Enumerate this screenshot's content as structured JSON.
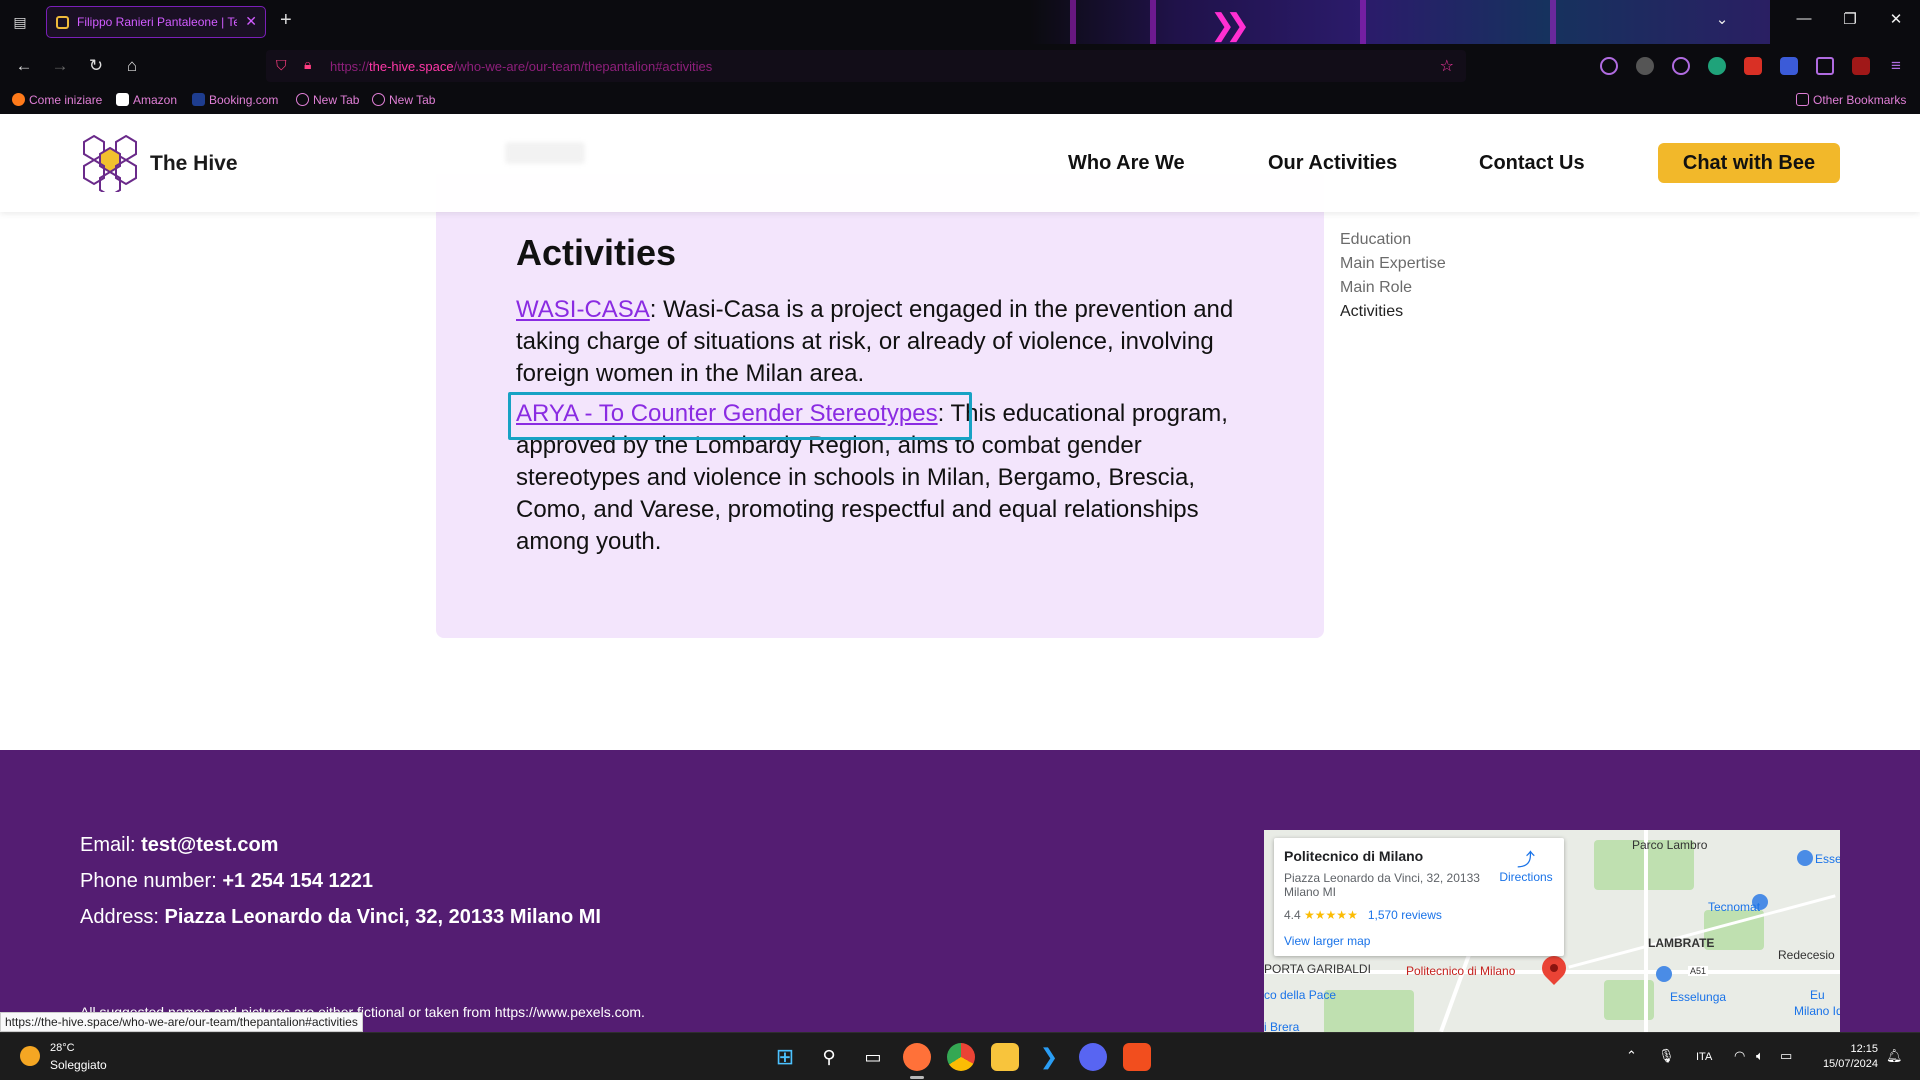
{
  "browser": {
    "tab_title": "Filippo Ranieri Pantaleone | Tea",
    "url_prefix": "https://",
    "url_domain": "the-hive.space",
    "url_path": "/who-we-are/our-team/thepantalion#activities",
    "bookmarks": [
      "Come iniziare",
      "Amazon",
      "Booking.com",
      "New Tab",
      "New Tab"
    ],
    "other_bookmarks": "Other Bookmarks"
  },
  "site": {
    "name": "The Hive",
    "nav": [
      "Who Are We",
      "Our Activities",
      "Contact Us"
    ],
    "cta": "Chat with Bee"
  },
  "activities": {
    "heading": "Activities",
    "items": [
      {
        "link": "WASI-CASA",
        "text": ": Wasi-Casa is a project engaged in the prevention and taking charge of situations at risk, or already of violence, involving foreign women in the Milan area."
      },
      {
        "link": "ARYA - To Counter Gender Stereotypes",
        "text": ": This educational program, approved by the Lombardy Region, aims to combat gender stereotypes and violence in schools in Milan, Bergamo, Brescia, Como, and Varese, promoting respectful and equal relationships among youth."
      }
    ]
  },
  "toc": [
    "Education",
    "Main Expertise",
    "Main Role",
    "Activities"
  ],
  "footer": {
    "email_label": "Email: ",
    "email": "test@test.com",
    "phone_label": "Phone number: ",
    "phone": "+1 254 154 1221",
    "address_label": "Address: ",
    "address": "Piazza Leonardo da Vinci, 32, 20133 Milano MI",
    "disclaimer": "All suggested names and pictures are either fictional or taken from https://www.pexels.com."
  },
  "map": {
    "place": "Politecnico di Milano",
    "address": "Piazza Leonardo da Vinci, 32, 20133 Milano MI",
    "rating": "4.4",
    "stars": "★★★★★",
    "reviews": "1,570 reviews",
    "directions": "Directions",
    "view_larger": "View larger map",
    "labels": [
      "Parco Lambro",
      "Tecnomat",
      "LAMBRATE",
      "Redecesio",
      "PORTA GARIBALDI",
      "Politecnico di Milano",
      "Esselunga",
      "Milano Idro",
      "co della Pace",
      "i Brera",
      "Esse",
      "A51",
      "Eu"
    ]
  },
  "status_bar_url": "https://the-hive.space/who-we-are/our-team/thepantalion#activities",
  "taskbar": {
    "temp": "28°C",
    "weather": "Soleggiato",
    "lang": "ITA",
    "time": "12:15",
    "date": "15/07/2024"
  },
  "colors": {
    "accent_purple": "#541d72",
    "card_bg": "#f3e5fc",
    "cta_yellow": "#f2b82a",
    "link_purple": "#8a2be2",
    "focus_cyan": "#17a2c4"
  }
}
